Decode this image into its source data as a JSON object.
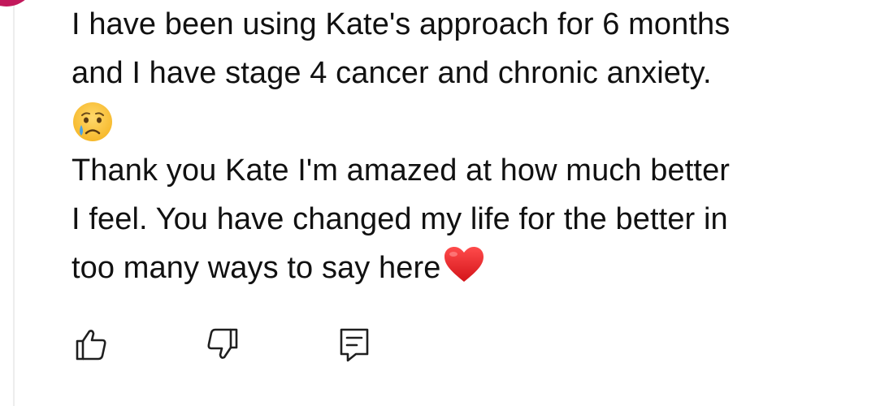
{
  "comment": {
    "lines": [
      "I have been using Kate's approach for 6 months",
      "and I have stage 4 cancer and chronic anxiety.",
      "Thank you Kate I'm amazed at how much better",
      "I feel. You have changed my life for the better in",
      "too many ways to say here"
    ],
    "emoji_inline": "crying-face",
    "emoji_end": "red-heart"
  },
  "actions": {
    "like_icon": "thumbs-up-icon",
    "dislike_icon": "thumbs-down-icon",
    "reply_icon": "reply-comment-icon"
  },
  "colors": {
    "avatar": "#c2185b",
    "text": "#111111",
    "icon": "#1f1f1f"
  }
}
